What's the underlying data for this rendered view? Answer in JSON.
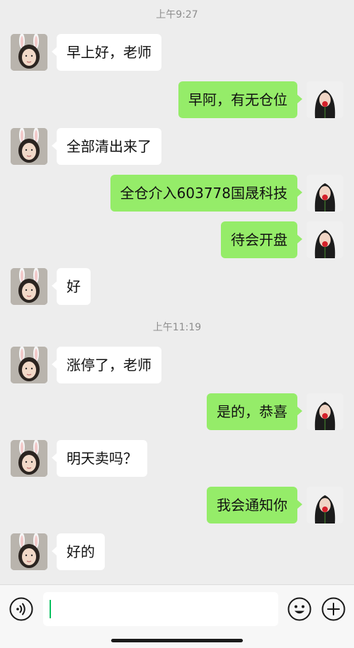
{
  "messages": [
    {
      "type": "time",
      "text": "上午9:27"
    },
    {
      "type": "msg",
      "side": "left",
      "text": "早上好，老师"
    },
    {
      "type": "msg",
      "side": "right",
      "text": "早阿，有无仓位"
    },
    {
      "type": "msg",
      "side": "left",
      "text": "全部清出来了"
    },
    {
      "type": "msg",
      "side": "right",
      "text": "全仓介入603778国晟科技"
    },
    {
      "type": "msg",
      "side": "right",
      "text": "待会开盘"
    },
    {
      "type": "msg",
      "side": "left",
      "text": "好"
    },
    {
      "type": "time",
      "text": "上午11:19"
    },
    {
      "type": "msg",
      "side": "left",
      "text": "涨停了，老师"
    },
    {
      "type": "msg",
      "side": "right",
      "text": "是的，恭喜"
    },
    {
      "type": "msg",
      "side": "left",
      "text": "明天卖吗？"
    },
    {
      "type": "msg",
      "side": "right",
      "text": "我会通知你"
    },
    {
      "type": "msg",
      "side": "left",
      "text": "好的"
    }
  ],
  "input": {
    "value": ""
  },
  "icons": {
    "voice": "voice-icon",
    "emoji": "emoji-icon",
    "plus": "plus-icon"
  },
  "colors": {
    "sent_bubble": "#95ec69",
    "received_bubble": "#ffffff",
    "background": "#ededed",
    "caret": "#07c160"
  }
}
